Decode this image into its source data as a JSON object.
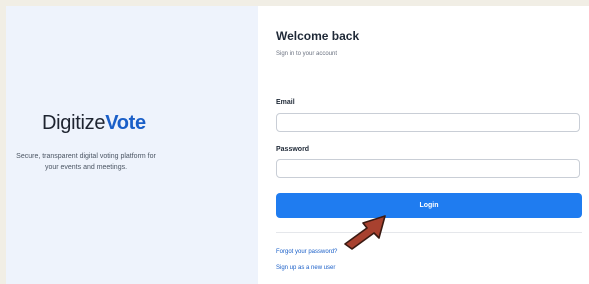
{
  "brand": {
    "name_part1": "Digitize",
    "name_part2": "Vote",
    "tagline": "Secure, transparent digital voting platform for your events and meetings."
  },
  "login": {
    "title": "Welcome back",
    "subtitle": "Sign in to your account",
    "email_label": "Email",
    "email_value": "",
    "password_label": "Password",
    "password_value": "",
    "login_button": "Login",
    "forgot_link": "Forgot your password?",
    "signup_link": "Sign up as a new user"
  },
  "colors": {
    "accent": "#1f7cf0",
    "link": "#1a5fc8",
    "left_panel_bg": "#eef3fc",
    "annotation_arrow": "#a8412f"
  },
  "annotation": {
    "icon": "arrow-pointer-icon"
  }
}
